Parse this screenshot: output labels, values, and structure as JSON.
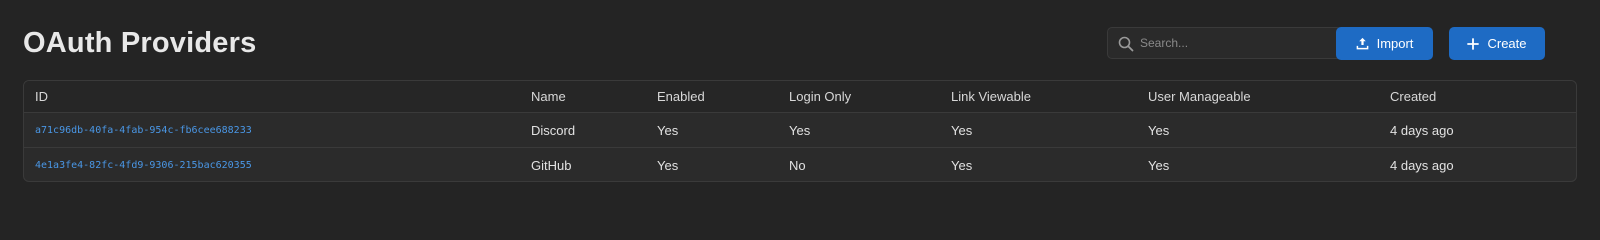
{
  "header": {
    "title": "OAuth Providers",
    "search_placeholder": "Search...",
    "import_label": "Import",
    "create_label": "Create"
  },
  "colors": {
    "background": "#242424",
    "accent": "#1e6bc4",
    "link": "#4a97e6"
  },
  "table": {
    "columns": [
      "ID",
      "Name",
      "Enabled",
      "Login Only",
      "Link Viewable",
      "User Manageable",
      "Created"
    ],
    "rows": [
      {
        "id": "a71c96db-40fa-4fab-954c-fb6cee688233",
        "name": "Discord",
        "enabled": "Yes",
        "login_only": "Yes",
        "link_viewable": "Yes",
        "user_manageable": "Yes",
        "created": "4 days ago"
      },
      {
        "id": "4e1a3fe4-82fc-4fd9-9306-215bac620355",
        "name": "GitHub",
        "enabled": "Yes",
        "login_only": "No",
        "link_viewable": "Yes",
        "user_manageable": "Yes",
        "created": "4 days ago"
      }
    ]
  }
}
